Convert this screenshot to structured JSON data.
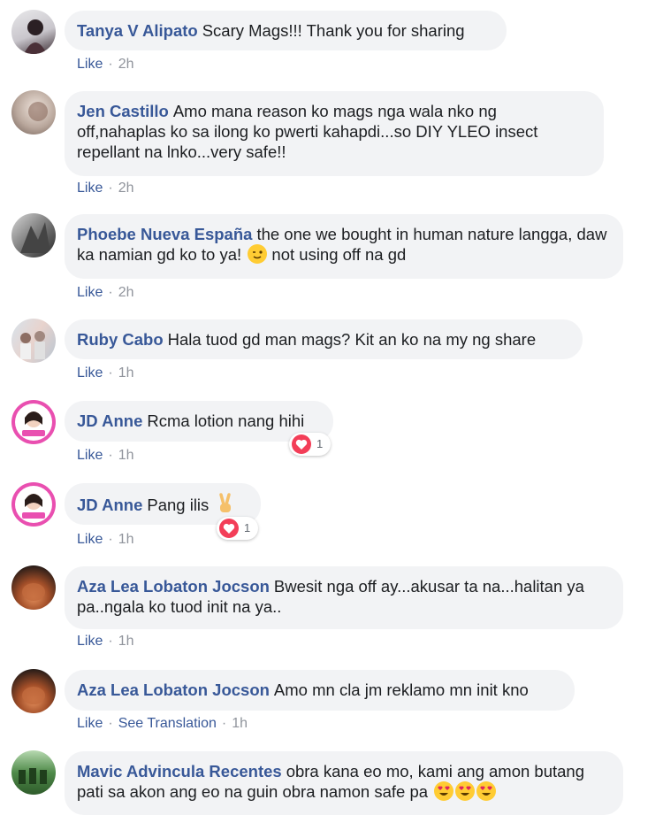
{
  "comments": [
    {
      "author": "Tanya V Alipato",
      "text": "Scary Mags!!! Thank you for sharing",
      "like": "Like",
      "time": "2h"
    },
    {
      "author": "Jen Castillo",
      "text": "Amo mana reason ko mags nga wala nko ng off,nahaplas ko sa ilong ko pwerti kahapdi...so DIY YLEO insect repellant na lnko...very safe!!",
      "like": "Like",
      "time": "2h"
    },
    {
      "author": "Phoebe Nueva España",
      "text": "the one we bought in human nature langga, daw ka namian gd ko to ya!",
      "text_after": "not using off na gd",
      "like": "Like",
      "time": "2h"
    },
    {
      "author": "Ruby Cabo",
      "text": "Hala tuod gd man mags? Kit an ko na my ng share",
      "like": "Like",
      "time": "1h"
    },
    {
      "author": "JD Anne",
      "text": "Rcma lotion nang hihi",
      "like": "Like",
      "time": "1h",
      "reaction_count": "1"
    },
    {
      "author": "JD Anne",
      "text": "Pang ilis",
      "like": "Like",
      "time": "1h",
      "reaction_count": "1"
    },
    {
      "author": "Aza Lea Lobaton Jocson",
      "text": "Bwesit nga off ay...akusar ta na...halitan ya pa..ngala ko tuod init na ya..",
      "like": "Like",
      "time": "1h"
    },
    {
      "author": "Aza Lea Lobaton Jocson",
      "text": "Amo mn cla jm reklamo mn init kno",
      "like": "Like",
      "see_translation": "See Translation",
      "time": "1h"
    },
    {
      "author": "Mavic Advincula Recentes",
      "text": "obra kana eo mo, kami ang amon butang pati sa akon ang eo na guin obra namon safe pa"
    }
  ],
  "colors": {
    "author": "#385898",
    "bubble": "#f2f3f5",
    "meta": "#90949c",
    "love": "#f33e58"
  }
}
